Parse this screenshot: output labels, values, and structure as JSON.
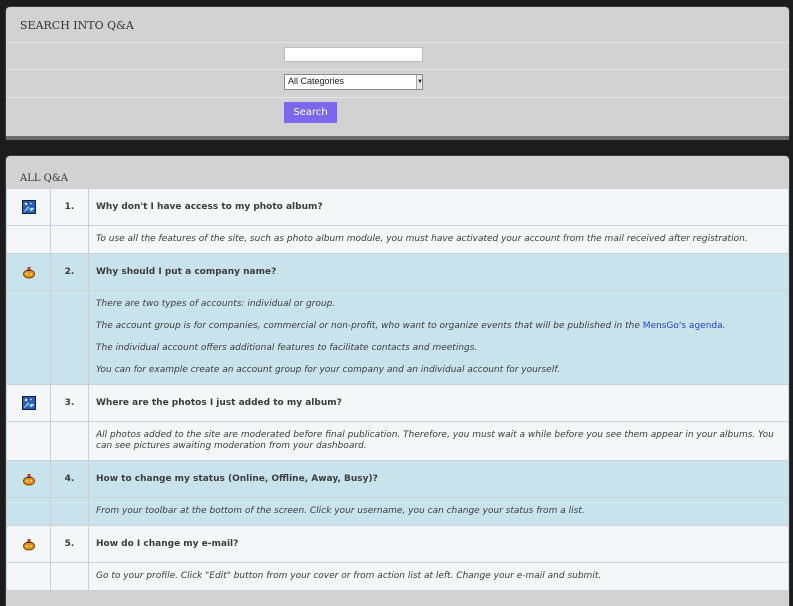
{
  "search": {
    "title": "SEARCH INTO Q&A",
    "input_value": "",
    "category_selected": "All Categories",
    "button_label": "Search"
  },
  "qa": {
    "title": "ALL Q&A",
    "items": [
      {
        "icon": "photo-icon",
        "number": "1.",
        "question": "Why don't I have access to my photo album?",
        "answer": [
          "To use all the features of the site, such as photo album module, you must have activated your account from the mail received after registration."
        ]
      },
      {
        "icon": "company-icon",
        "number": "2.",
        "question": "Why should I put a company name?",
        "answer": [
          "There are two types of accounts: individual or group.",
          "The account group is for companies, commercial or non-profit, who want to organize events that will be published in the",
          "The individual account offers additional features to facilitate contacts and meetings.",
          "You can for example create an account group for your company and an individual account for yourself."
        ],
        "link_text": "MensGo's agenda"
      },
      {
        "icon": "photo-icon",
        "number": "3.",
        "question": "Where are the photos I just added to my album?",
        "answer": [
          "All photos added to the site are moderated before final publication. Therefore, you must  wait a while before you see them appear in your albums. You can see pictures awaiting moderation from your dashboard."
        ]
      },
      {
        "icon": "company-icon",
        "number": "4.",
        "question": "How to change my status (Online, Offline, Away, Busy)?",
        "answer": [
          "From your toolbar at the bottom of the screen. Click your username, you can change your status from a list."
        ]
      },
      {
        "icon": "company-icon",
        "number": "5.",
        "question": "How do I change my e-mail?",
        "answer": [
          "Go to your profile. Click \"Edit\" button from your cover or from action list at left. Change your e-mail and submit."
        ]
      }
    ]
  },
  "colors": {
    "accent": "#7b68ee",
    "row_blue": "#c9e3ed",
    "row_white": "#f5f6f8",
    "link": "#1a3dd6"
  }
}
